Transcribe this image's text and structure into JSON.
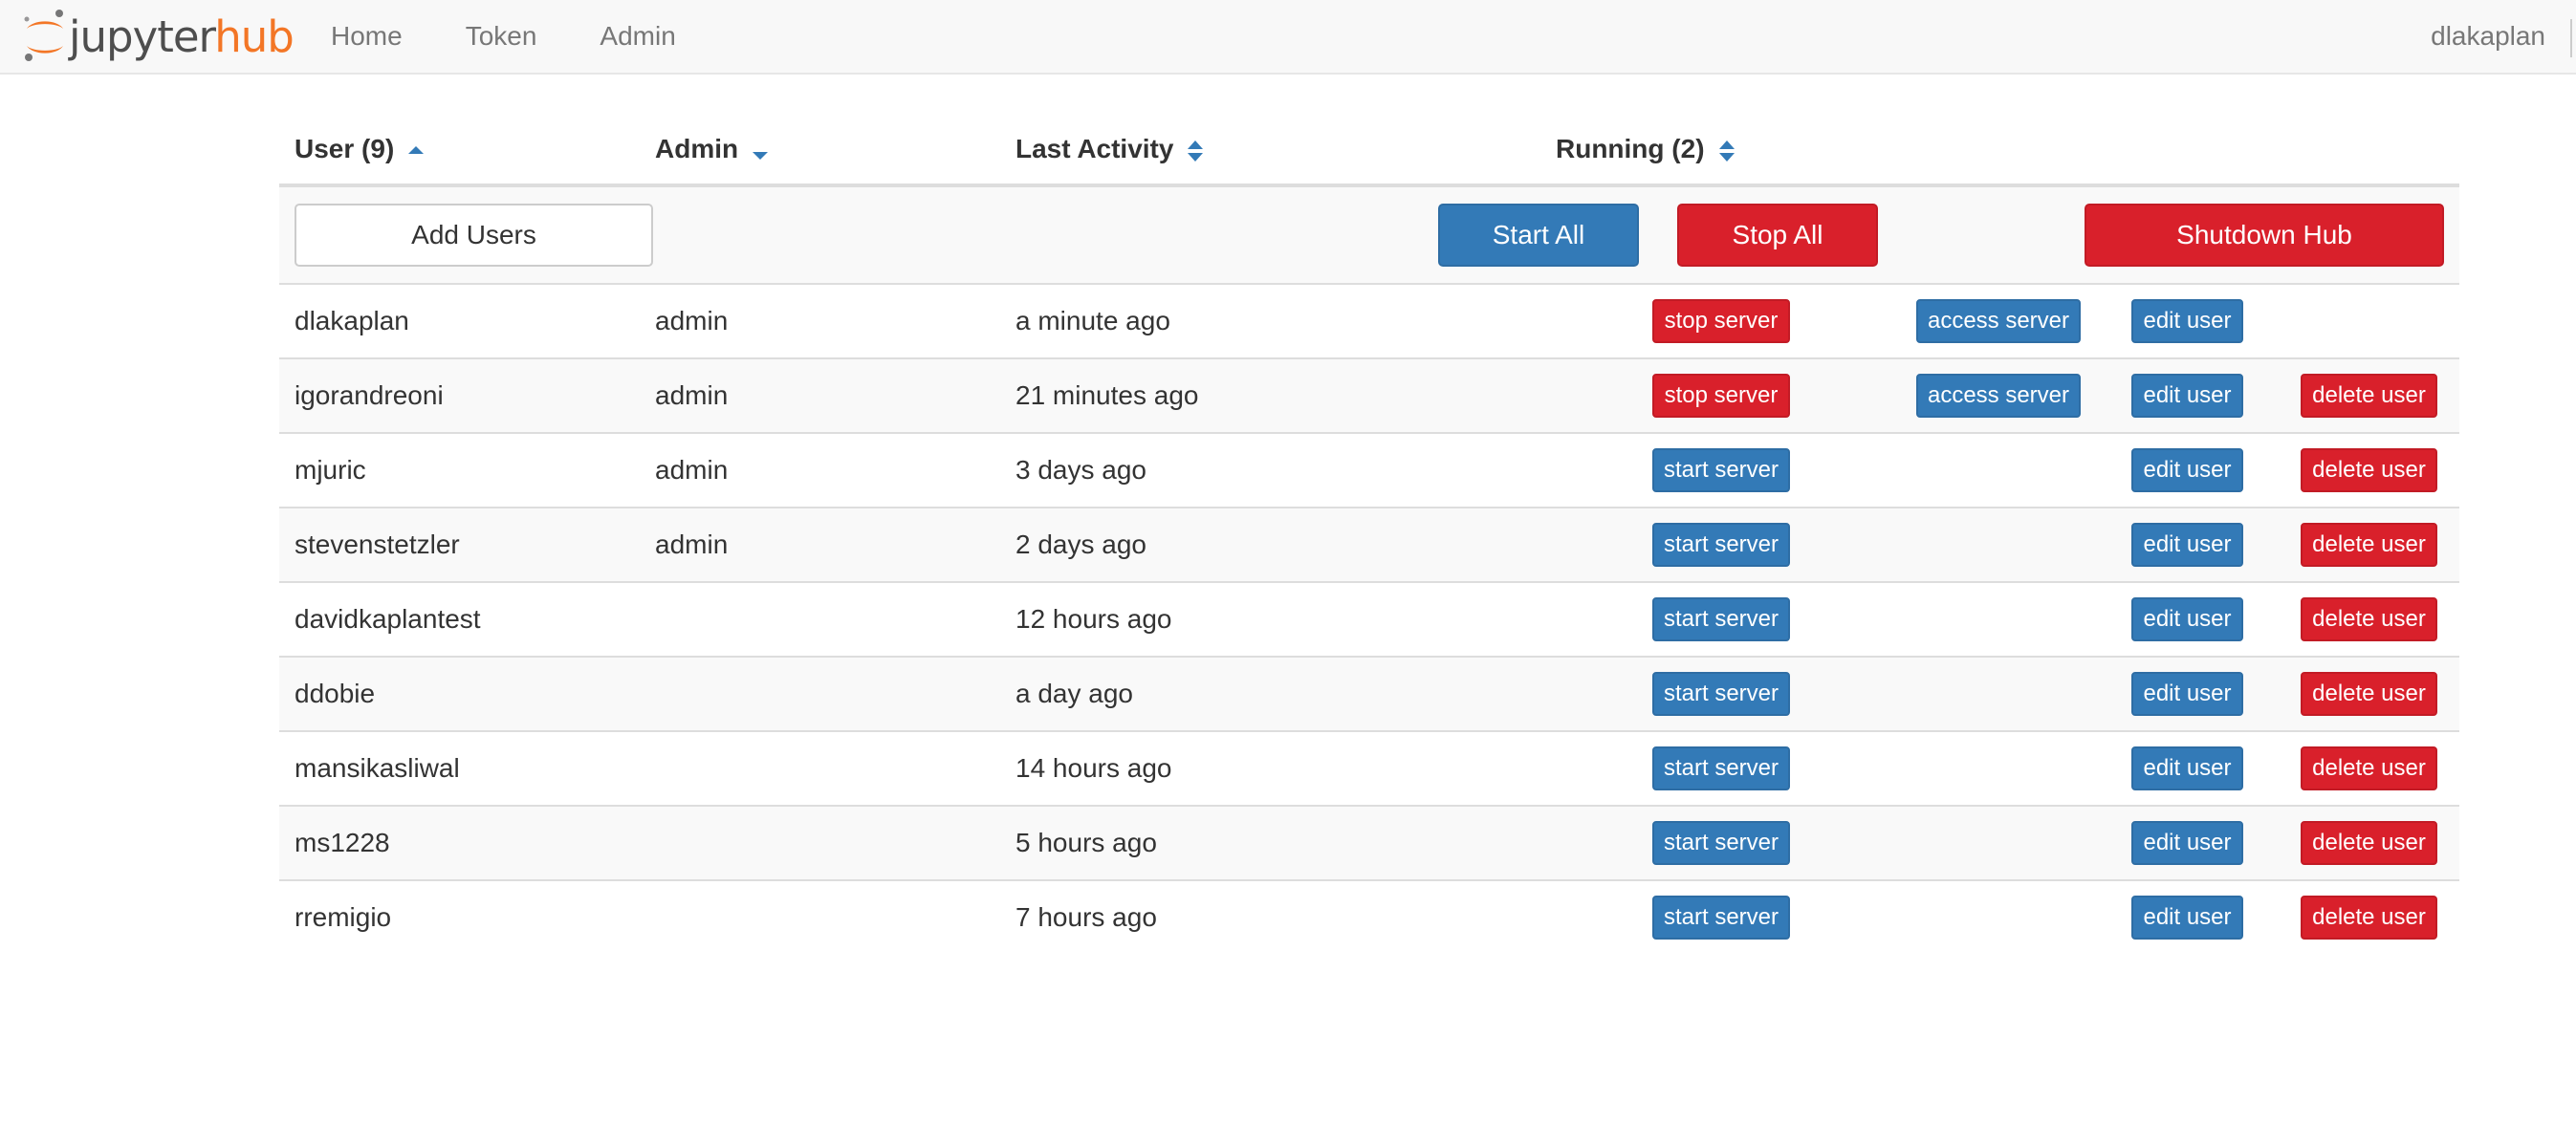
{
  "nav": {
    "brand_part1": "jupyter",
    "brand_part2": "hub",
    "links": [
      "Home",
      "Token",
      "Admin"
    ],
    "user": "dlakaplan"
  },
  "table": {
    "columns": {
      "user": "User (9)",
      "admin": "Admin",
      "last_activity": "Last Activity",
      "running": "Running (2)"
    },
    "controls": {
      "add_users": "Add Users",
      "start_all": "Start All",
      "stop_all": "Stop All",
      "shutdown_hub": "Shutdown Hub"
    },
    "rows": [
      {
        "name": "dlakaplan",
        "admin": "admin",
        "activity": "a minute ago",
        "server_action": "stop server",
        "access": "access server",
        "edit": "edit user",
        "delete": ""
      },
      {
        "name": "igorandreoni",
        "admin": "admin",
        "activity": "21 minutes ago",
        "server_action": "stop server",
        "access": "access server",
        "edit": "edit user",
        "delete": "delete user"
      },
      {
        "name": "mjuric",
        "admin": "admin",
        "activity": "3 days ago",
        "server_action": "start server",
        "access": "",
        "edit": "edit user",
        "delete": "delete user"
      },
      {
        "name": "stevenstetzler",
        "admin": "admin",
        "activity": "2 days ago",
        "server_action": "start server",
        "access": "",
        "edit": "edit user",
        "delete": "delete user"
      },
      {
        "name": "davidkaplantest",
        "admin": "",
        "activity": "12 hours ago",
        "server_action": "start server",
        "access": "",
        "edit": "edit user",
        "delete": "delete user"
      },
      {
        "name": "ddobie",
        "admin": "",
        "activity": "a day ago",
        "server_action": "start server",
        "access": "",
        "edit": "edit user",
        "delete": "delete user"
      },
      {
        "name": "mansikasliwal",
        "admin": "",
        "activity": "14 hours ago",
        "server_action": "start server",
        "access": "",
        "edit": "edit user",
        "delete": "delete user"
      },
      {
        "name": "ms1228",
        "admin": "",
        "activity": "5 hours ago",
        "server_action": "start server",
        "access": "",
        "edit": "edit user",
        "delete": "delete user"
      },
      {
        "name": "rremigio",
        "admin": "",
        "activity": "7 hours ago",
        "server_action": "start server",
        "access": "",
        "edit": "edit user",
        "delete": "delete user"
      }
    ]
  },
  "colors": {
    "primary": "#337ab7",
    "danger": "#d9202b",
    "brand_orange": "#f37626",
    "navbar_bg": "#f8f8f8"
  },
  "icons": {
    "logo": "jupyter-logo-icon",
    "sort_asc": "sort-asc-icon",
    "sort_desc": "sort-desc-icon",
    "sort_both": "sort-icon"
  }
}
